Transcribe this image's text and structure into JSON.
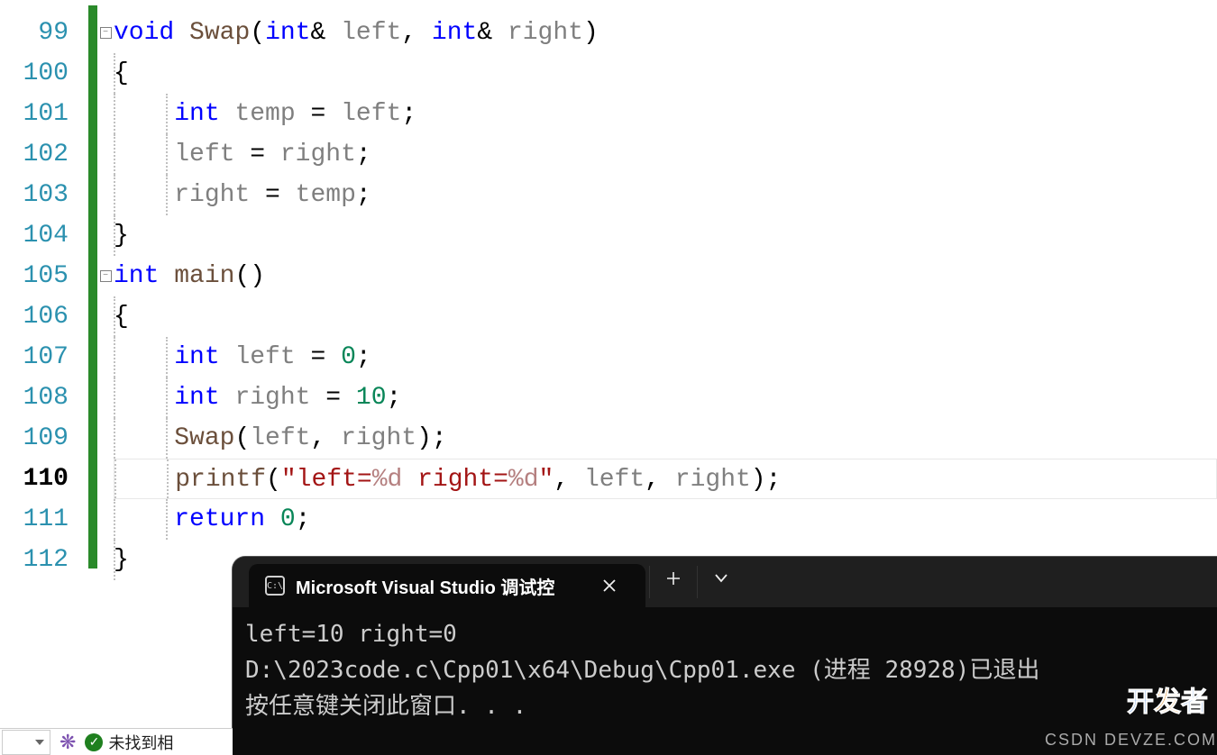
{
  "lines": {
    "99": "99",
    "100": "100",
    "101": "101",
    "102": "102",
    "103": "103",
    "104": "104",
    "105": "105",
    "106": "106",
    "107": "107",
    "108": "108",
    "109": "109",
    "110": "110",
    "111": "111",
    "112": "112"
  },
  "current_line": "110",
  "code": {
    "99": {
      "kw1": "void",
      "sp1": " ",
      "fn": "Swap",
      "p1": "(",
      "kw2": "int",
      "amp1": "& ",
      "id1": "left",
      "c1": ", ",
      "kw3": "int",
      "amp2": "& ",
      "id2": "right",
      "p2": ")"
    },
    "100": {
      "punc": "{"
    },
    "101": {
      "indent": "    ",
      "kw": "int",
      "sp": " ",
      "id1": "temp",
      "sp2": " = ",
      "id2": "left",
      "sc": ";"
    },
    "102": {
      "indent": "    ",
      "id1": "left",
      "sp": " = ",
      "id2": "right",
      "sc": ";"
    },
    "103": {
      "indent": "    ",
      "id1": "right",
      "sp": " = ",
      "id2": "temp",
      "sc": ";"
    },
    "104": {
      "punc": "}"
    },
    "105": {
      "kw1": "int",
      "sp": " ",
      "fn": "main",
      "p": "()"
    },
    "106": {
      "punc": "{"
    },
    "107": {
      "indent": "    ",
      "kw": "int",
      "sp": " ",
      "id": "left",
      "sp2": " = ",
      "num": "0",
      "sc": ";"
    },
    "108": {
      "indent": "    ",
      "kw": "int",
      "sp": " ",
      "id": "right",
      "sp2": " = ",
      "num": "10",
      "sc": ";"
    },
    "109": {
      "indent": "    ",
      "fn": "Swap",
      "p1": "(",
      "id1": "left",
      "c": ", ",
      "id2": "right",
      "p2": ")",
      "sc": ";"
    },
    "110": {
      "indent": "    ",
      "fn": "printf",
      "p1": "(",
      "q1": "\"",
      "s1": "left=",
      "e1": "%d",
      "s2": " right=",
      "e2": "%d",
      "q2": "\"",
      "c1": ", ",
      "id1": "left",
      "c2": ", ",
      "id2": "right",
      "p2": ")",
      "sc": ";"
    },
    "111": {
      "indent": "    ",
      "kw": "return",
      "sp": " ",
      "num": "0",
      "sc": ";"
    },
    "112": {
      "punc": "}"
    }
  },
  "console": {
    "tab_title": "Microsoft Visual Studio 调试控",
    "out_line1": "left=10 right=0",
    "out_line2": "D:\\2023code.c\\Cpp01\\x64\\Debug\\Cpp01.exe (进程 28928)已退出",
    "out_line3": "按任意键关闭此窗口. . . "
  },
  "status": {
    "text": "未找到相"
  },
  "watermark": {
    "text": "DEVZE.COM",
    "csdn": "CSDN"
  }
}
